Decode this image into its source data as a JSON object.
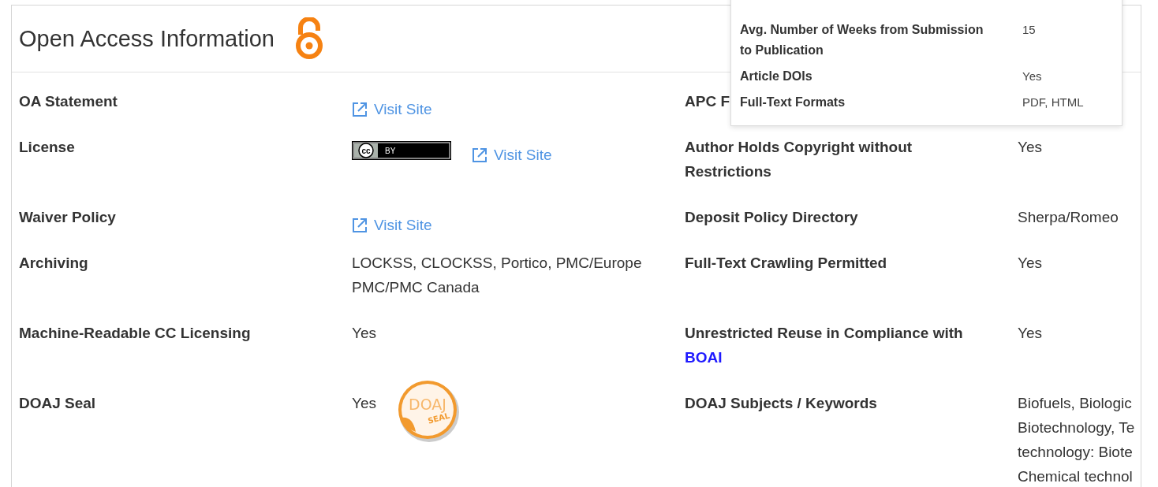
{
  "card": {
    "title": "Open Access Information"
  },
  "rows": [
    {
      "left": {
        "label": "OA Statement",
        "values": [
          {
            "kind": "link",
            "text": "Visit Site"
          }
        ]
      },
      "right": {
        "label": "APC F"
      }
    },
    {
      "left": {
        "label": "License",
        "values": [
          {
            "kind": "license-badge",
            "cc": "cc",
            "text": "BY"
          },
          {
            "kind": "link",
            "text": "Visit Site"
          }
        ]
      },
      "right": {
        "label": "Author Holds Copyright without Restrictions",
        "lines": [
          "Yes"
        ]
      }
    },
    {
      "left": {
        "label": "Waiver Policy",
        "values": [
          {
            "kind": "link",
            "text": "Visit Site"
          }
        ]
      },
      "right": {
        "label": "Deposit Policy Directory",
        "lines": [
          "Sherpa/Romeo"
        ]
      }
    },
    {
      "left": {
        "label": "Archiving",
        "values": [
          {
            "kind": "text",
            "text": "LOCKSS, CLOCKSS, Portico, PMC/Europe PMC/PMC Canada"
          }
        ]
      },
      "right": {
        "label": "Full-Text Crawling Permitted",
        "lines": [
          "Yes"
        ]
      }
    },
    {
      "left": {
        "label": "Machine-Readable CC Licensing",
        "values": [
          {
            "kind": "text",
            "text": "Yes"
          }
        ]
      },
      "right": {
        "label": "Unrestricted Reuse in Compliance with",
        "label_link": "BOAI",
        "lines": [
          "Yes"
        ]
      }
    },
    {
      "left": {
        "label": "DOAJ Seal",
        "values": [
          {
            "kind": "text",
            "text": "Yes"
          },
          {
            "kind": "seal",
            "text": "DOAJ",
            "sub": "SEAL"
          }
        ]
      },
      "right": {
        "label": "DOAJ Subjects / Keywords",
        "lines": [
          "Biofuels, Biologic",
          "Biotechnology, Te",
          "technology: Biote",
          "Chemical technol"
        ]
      }
    }
  ],
  "popup": {
    "rows": [
      {
        "label": "Avg. Number of Weeks from Submission to Publication",
        "value": "15"
      },
      {
        "label": "Article DOIs",
        "value": "Yes"
      },
      {
        "label": "Full-Text Formats",
        "value": "PDF, HTML"
      }
    ]
  }
}
